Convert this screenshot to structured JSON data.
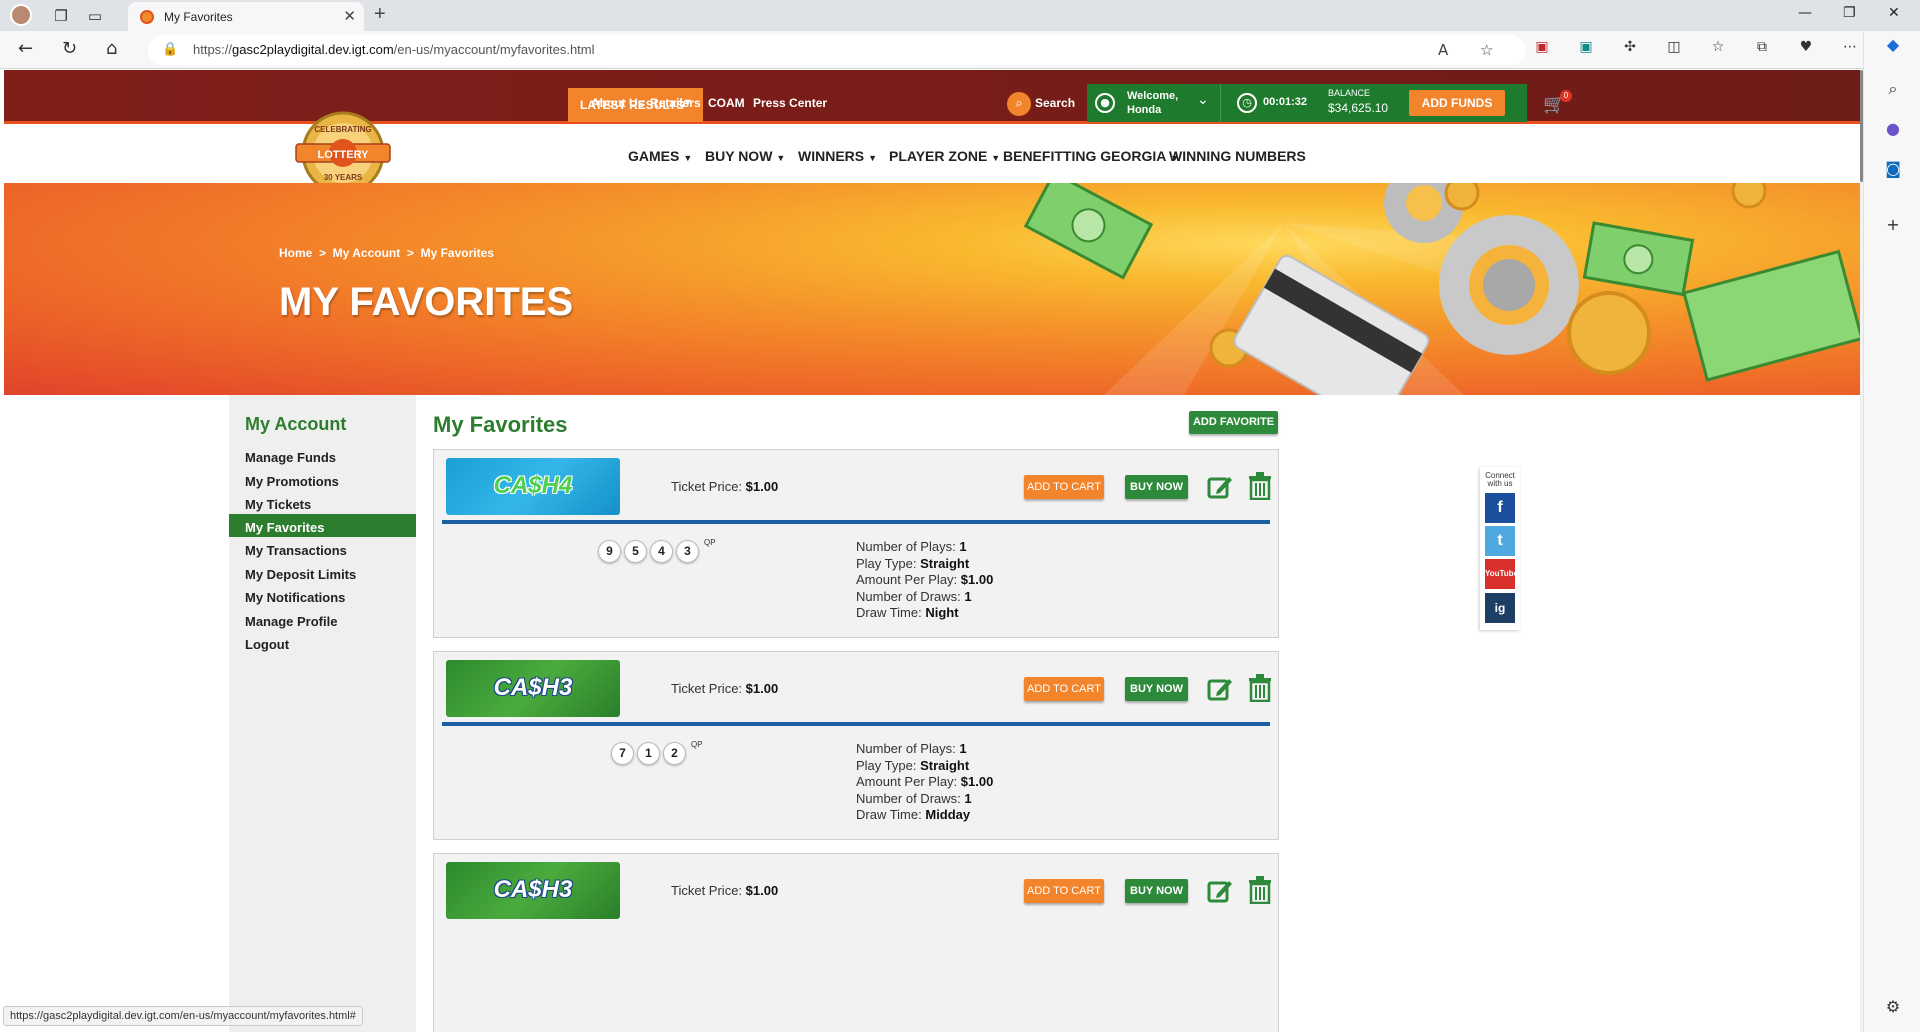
{
  "browser": {
    "tab_title": "My Favorites",
    "url_prefix": "https://",
    "url_host": "gasc2playdigital.dev.igt.com",
    "url_path": "/en-us/myaccount/myfavorites.html",
    "status_url": "https://gasc2playdigital.dev.igt.com/en-us/myaccount/myfavorites.html#"
  },
  "util": {
    "latest_results": "LATEST RESULTS",
    "links": [
      "About Us",
      "Retailers",
      "COAM",
      "Press Center"
    ],
    "search": "Search",
    "welcome_line1": "Welcome,",
    "welcome_line2": "Honda",
    "timer": "00:01:32",
    "balance_label": "BALANCE",
    "balance_value": "$34,625.10",
    "add_funds": "ADD FUNDS",
    "cart_count": "0"
  },
  "logo": {
    "top": "CELEBRATING",
    "name": "LOTTERY",
    "bottom": "30 YEARS"
  },
  "nav": [
    "GAMES",
    "BUY NOW",
    "WINNERS",
    "PLAYER ZONE",
    "BENEFITTING GEORGIA",
    "WINNING NUMBERS"
  ],
  "breadcrumb": "Home  >  My Account  >  My Favorites",
  "page_title": "MY FAVORITES",
  "sidebar": {
    "title": "My Account",
    "items": [
      "Manage Funds",
      "My Promotions",
      "My Tickets",
      "My Favorites",
      "My Transactions",
      "My Deposit Limits",
      "My Notifications",
      "Manage Profile",
      "Logout"
    ]
  },
  "content": {
    "title": "My Favorites",
    "add_favorite": "ADD FAVORITE",
    "price_label": "Ticket Price:",
    "add_to_cart": "ADD TO CART",
    "buy_now": "BUY NOW",
    "qp": "QP",
    "labels": {
      "plays": "Number of Plays:",
      "type": "Play Type:",
      "amount": "Amount Per Play:",
      "draws": "Number of Draws:",
      "time": "Draw Time:"
    },
    "favorites": [
      {
        "game": "CA$H4",
        "price": "$1.00",
        "numbers": [
          "9",
          "5",
          "4",
          "3"
        ],
        "plays": "1",
        "type": "Straight",
        "amount": "$1.00",
        "draws": "1",
        "time": "Night"
      },
      {
        "game": "CA$H3",
        "price": "$1.00",
        "numbers": [
          "7",
          "1",
          "2"
        ],
        "plays": "1",
        "type": "Straight",
        "amount": "$1.00",
        "draws": "1",
        "time": "Midday"
      },
      {
        "game": "CA$H3",
        "price": "$1.00"
      }
    ]
  },
  "social": {
    "label": "Connect with us",
    "items": [
      "f",
      "t",
      "YouTube",
      "ig"
    ]
  },
  "colors": {
    "brand_green": "#2d7d2f",
    "orange": "#f2842c",
    "maroon": "#7e1f1a",
    "rule_blue": "#1b5fa5"
  }
}
